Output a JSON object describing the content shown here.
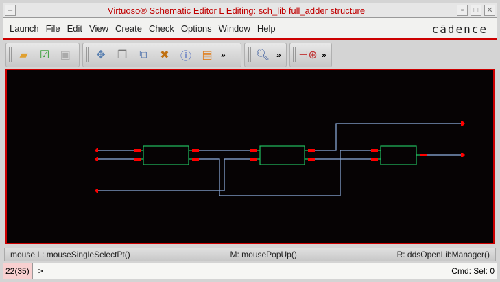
{
  "window": {
    "title": "Virtuoso® Schematic Editor L Editing: sch_lib full_adder structure"
  },
  "menu": [
    "Launch",
    "File",
    "Edit",
    "View",
    "Create",
    "Check",
    "Options",
    "Window",
    "Help"
  ],
  "brand": "cādence",
  "toolbars": [
    {
      "icons": [
        "open-folder-icon",
        "save-check-icon",
        "save-disk-icon"
      ]
    },
    {
      "icons": [
        "move-icon",
        "copy-icon",
        "stretch-icon",
        "delete-icon",
        "info-icon",
        "properties-icon"
      ],
      "more": "»"
    },
    {
      "icons": [
        "zoom-icon"
      ],
      "more": "»"
    },
    {
      "icons": [
        "add-instance-icon"
      ],
      "more": "»"
    }
  ],
  "colors": {
    "accent": "#cc0000",
    "wire": "#8fb0e0",
    "instance": "#22c060",
    "pin": "#ff0000",
    "canvas": "#060304"
  },
  "status": {
    "left": "mouse L: mouseSingleSelectPt()",
    "middle": "M: mousePopUp()",
    "right": "R: ddsOpenLibManager()"
  },
  "cmdline": {
    "counter": "22(35)",
    "prompt": ">",
    "sel": "Cmd: Sel: 0"
  }
}
